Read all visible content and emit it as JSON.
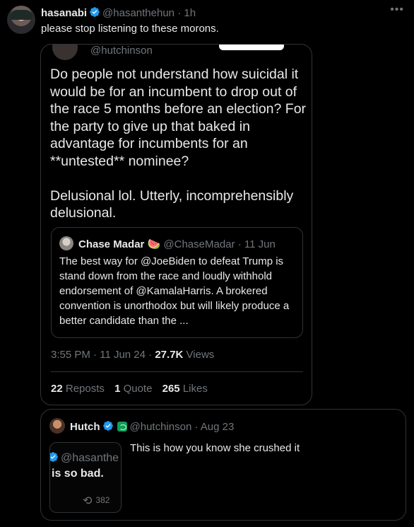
{
  "post": {
    "display_name": "hasanabi",
    "handle": "@hasanthehun",
    "separator": "·",
    "time": "1h",
    "text": "please stop listening to these morons.",
    "more_icon": "more-dots-icon"
  },
  "quoted_post": {
    "handle": "@hutchinson",
    "text": "Do people not understand how suicidal it would be for an incumbent to drop out of the race 5 months before an election? For the party to give up that baked in advantage for incumbents for an **untested** nominee?\n\nDelusional lol. Utterly, incomprehensibly delusional.",
    "inner_quote": {
      "display_name": "Chase Madar",
      "emoji": "🍉",
      "handle": "@ChaseMadar",
      "separator": "·",
      "date": "11 Jun",
      "text": "The best way for @JoeBiden to defeat Trump is stand down from the race and loudly withhold endorsement of @KamalaHarris. A brokered convention is unorthodox but will likely produce a better candidate than the ..."
    },
    "meta": {
      "time": "3:55 PM",
      "sep": "·",
      "date": "11 Jun 24",
      "views_count": "27.7K",
      "views_label": "Views"
    },
    "stats": {
      "reposts_count": "22",
      "reposts_label": "Reposts",
      "quotes_count": "1",
      "quotes_label": "Quote",
      "likes_count": "265",
      "likes_label": "Likes"
    }
  },
  "reply_card": {
    "display_name": "Hutch",
    "handle": "@hutchinson",
    "separator": "·",
    "date": "Aug 23",
    "text": "This is how you know she crushed it",
    "media": {
      "handle": "@hasanthe",
      "line": "is so bad.",
      "retweet_count": "382"
    }
  },
  "colors": {
    "background": "#000000",
    "text": "#e7e9ea",
    "muted": "#71767b",
    "border": "#2f3336",
    "verified": "#1d9bf0"
  }
}
